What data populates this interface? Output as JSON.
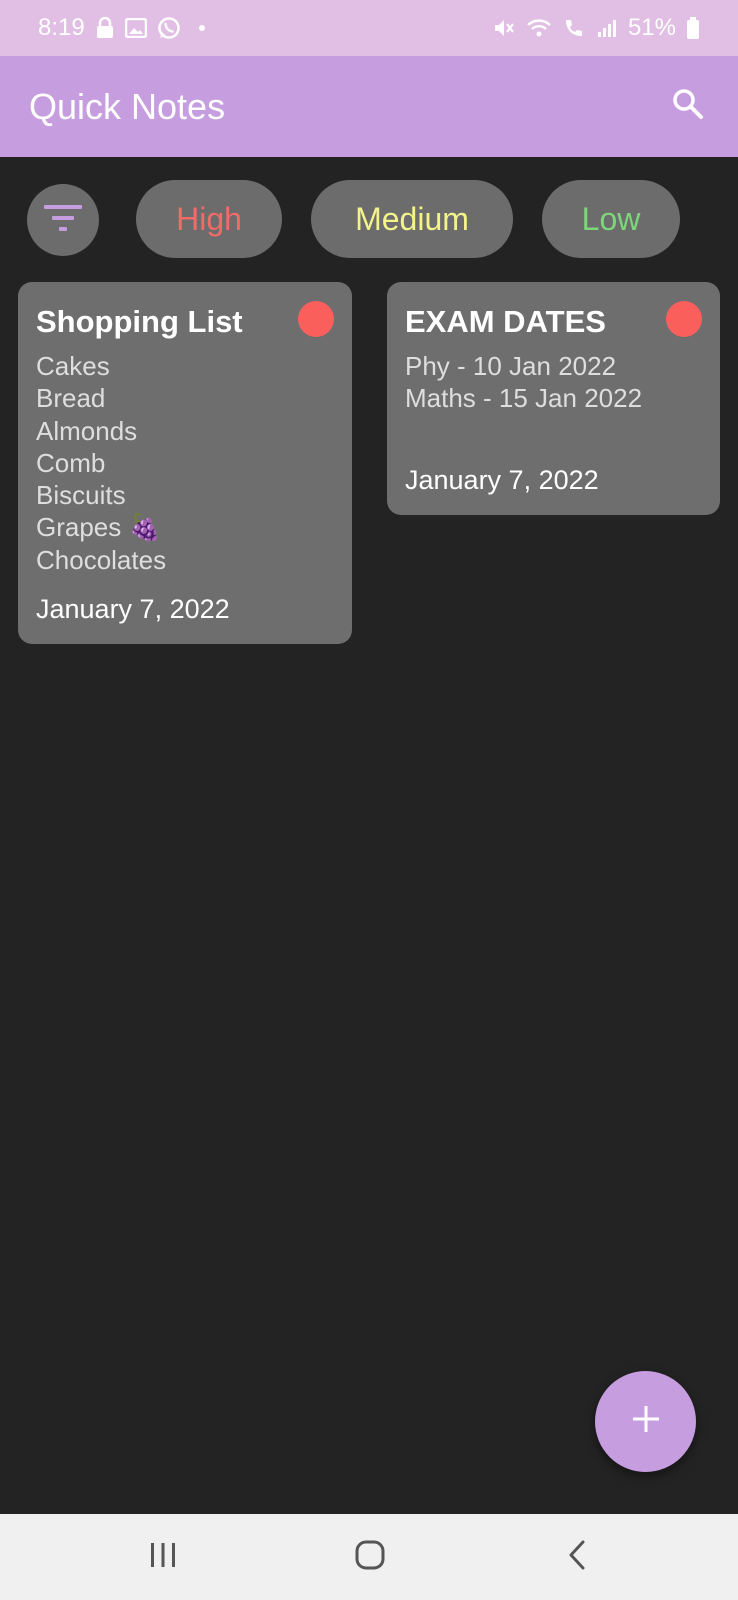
{
  "status_bar": {
    "time": "8:19",
    "battery": "51%",
    "icons": [
      "lock-icon",
      "image-icon",
      "whatsapp-icon",
      "mute-icon",
      "wifi-icon",
      "wifi-calling-icon",
      "signal-icon",
      "battery-icon"
    ]
  },
  "app_bar": {
    "title": "Quick Notes",
    "search_icon": "search-icon",
    "background": "#c69ddf"
  },
  "filters": {
    "filter_icon": "filter-icon",
    "chips": [
      {
        "label": "High",
        "color": "#f26b68"
      },
      {
        "label": "Medium",
        "color": "#f3f38a"
      },
      {
        "label": "Low",
        "color": "#7dd67a"
      }
    ]
  },
  "notes": [
    {
      "title": "Shopping List",
      "lines": [
        "Cakes",
        "Bread",
        "Almonds",
        "Comb",
        "Biscuits",
        "Grapes 🍇",
        "Chocolates"
      ],
      "date": "January 7, 2022",
      "priority_color": "#fb5f5b"
    },
    {
      "title": "EXAM DATES",
      "lines": [
        "Phy - 10 Jan 2022",
        "Maths - 15 Jan 2022"
      ],
      "date": "January 7, 2022",
      "priority_color": "#fb5f5b"
    }
  ],
  "fab": {
    "icon": "plus-icon",
    "label": "+"
  },
  "nav_bar": {
    "icons": [
      "recents-icon",
      "home-icon",
      "back-icon"
    ]
  }
}
